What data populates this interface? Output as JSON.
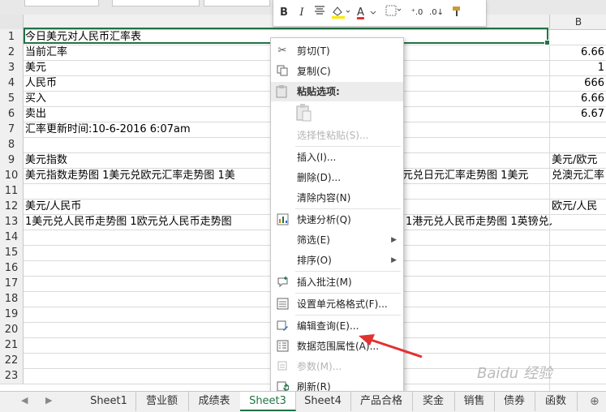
{
  "columns": {
    "B": "B"
  },
  "rows": [
    {
      "n": "1",
      "a": "今日美元对人民币汇率表",
      "b": ""
    },
    {
      "n": "2",
      "a": "当前汇率",
      "b": "6.66"
    },
    {
      "n": "3",
      "a": "美元",
      "b": "1"
    },
    {
      "n": "4",
      "a": "人民币",
      "b": "666"
    },
    {
      "n": "5",
      "a": "买入",
      "b": "6.66"
    },
    {
      "n": "6",
      "a": "卖出",
      "b": "6.67"
    },
    {
      "n": "7",
      "a": "汇率更新时间:10-6-2016 6:07am",
      "b": ""
    },
    {
      "n": "8",
      "a": "",
      "b": ""
    },
    {
      "n": "9",
      "a": "美元指数",
      "b": "美元/欧元"
    },
    {
      "n": "10",
      "a": "美元指数走势图  1美元兑欧元汇率走势图  1美",
      "a2": "元兑日元汇率走势图  1美元",
      "b": "兑澳元汇率"
    },
    {
      "n": "11",
      "a": "",
      "b": ""
    },
    {
      "n": "12",
      "a": "美元/人民币",
      "b": "欧元/人民"
    },
    {
      "n": "13",
      "a": "1美元兑人民币走势图  1欧元兑人民币走势图",
      "a2": "1港元兑人民币走势图  1英镑兑人民币"
    },
    {
      "n": "14"
    },
    {
      "n": "15"
    },
    {
      "n": "16"
    },
    {
      "n": "17"
    },
    {
      "n": "18"
    },
    {
      "n": "19"
    },
    {
      "n": "20"
    },
    {
      "n": "21"
    },
    {
      "n": "22"
    },
    {
      "n": "23"
    }
  ],
  "mini_toolbar": {
    "bold": "B",
    "italic": "I",
    "font_color": "A"
  },
  "context_menu": {
    "cut": "剪切(T)",
    "copy": "复制(C)",
    "paste_options": "粘贴选项:",
    "paste_special": "选择性粘贴(S)...",
    "insert": "插入(I)...",
    "delete": "删除(D)...",
    "clear": "清除内容(N)",
    "quick_analysis": "快速分析(Q)",
    "filter": "筛选(E)",
    "sort": "排序(O)",
    "insert_comment": "插入批注(M)",
    "format_cells": "设置单元格格式(F)...",
    "edit_query": "编辑查询(E)...",
    "range_props": "数据范围属性(A)...",
    "params": "参数(M)...",
    "refresh": "刷新(R)"
  },
  "tabs": [
    "Sheet1",
    "营业额",
    "成绩表",
    "Sheet3",
    "Sheet4",
    "产品合格",
    "奖金",
    "销售",
    "债券",
    "函数"
  ],
  "active_tab": "Sheet3",
  "watermark": "Baidu 经验",
  "colors": {
    "accent": "#217346",
    "arrow": "#e0322f"
  }
}
